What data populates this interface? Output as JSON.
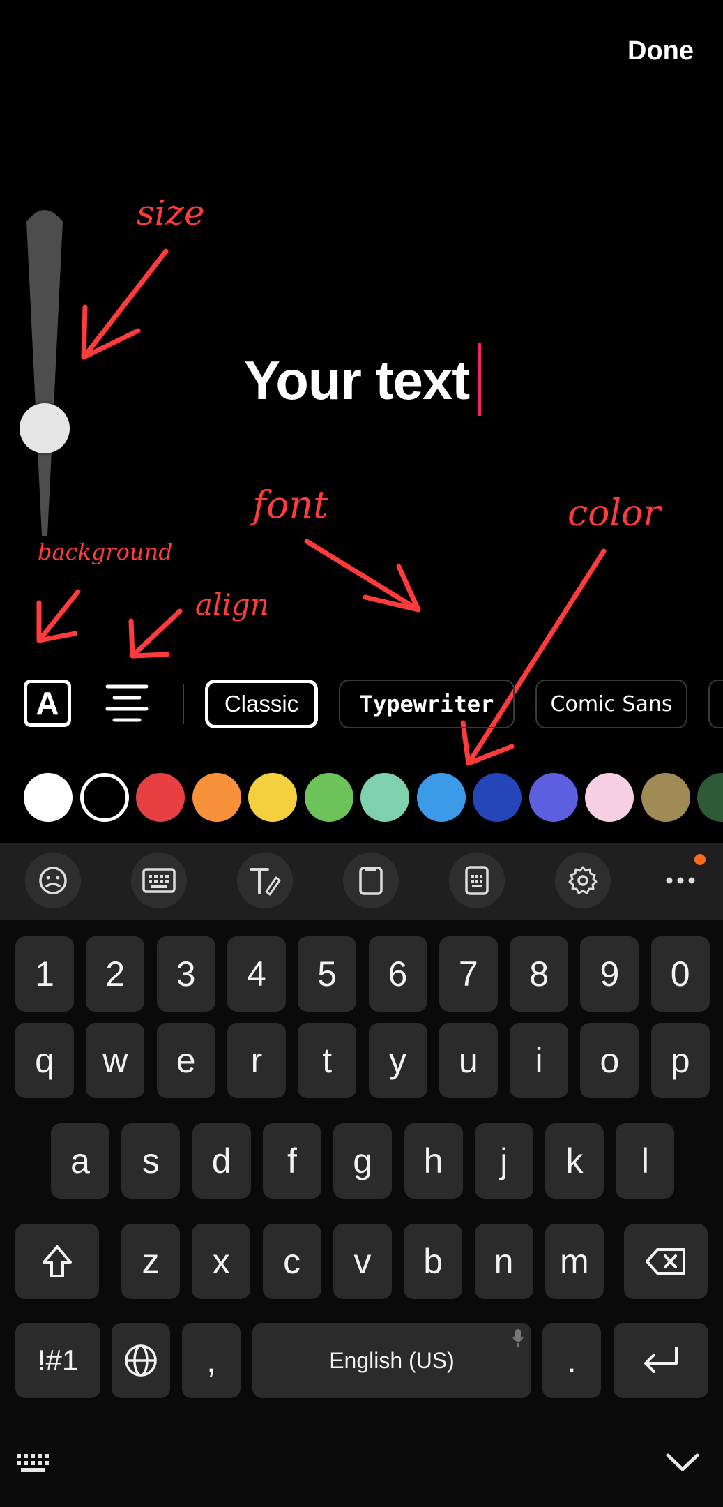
{
  "header": {
    "done_label": "Done"
  },
  "editor": {
    "text": "Your text",
    "size_level": 0.28
  },
  "annotations": {
    "size": "size",
    "background": "background",
    "align": "align",
    "font": "font",
    "color": "color"
  },
  "style_row": {
    "background_button_glyph": "A",
    "fonts": [
      "Classic",
      "Typewriter",
      "Comic Sans"
    ],
    "selected_font": "Classic"
  },
  "colors": [
    "#ffffff",
    "#000000",
    "#e84040",
    "#f7923a",
    "#f4d03f",
    "#6cc35a",
    "#7fd1ae",
    "#3b9be8",
    "#2546b8",
    "#5b5fe0",
    "#f6cfe2",
    "#a08a55",
    "#2f5a3a"
  ],
  "keyboard": {
    "toolbar_icons": [
      "emoji-icon",
      "keyboard-icon",
      "handwriting-icon",
      "clipboard-icon",
      "keyboard-mode-icon",
      "settings-icon",
      "more-icon"
    ],
    "rows": [
      [
        "1",
        "2",
        "3",
        "4",
        "5",
        "6",
        "7",
        "8",
        "9",
        "0"
      ],
      [
        "q",
        "w",
        "e",
        "r",
        "t",
        "y",
        "u",
        "i",
        "o",
        "p"
      ],
      [
        "a",
        "s",
        "d",
        "f",
        "g",
        "h",
        "j",
        "k",
        "l"
      ],
      [
        "z",
        "x",
        "c",
        "v",
        "b",
        "n",
        "m"
      ]
    ],
    "symbols_label": "!#1",
    "comma_label": ",",
    "space_label": "English (US)",
    "period_label": "."
  }
}
